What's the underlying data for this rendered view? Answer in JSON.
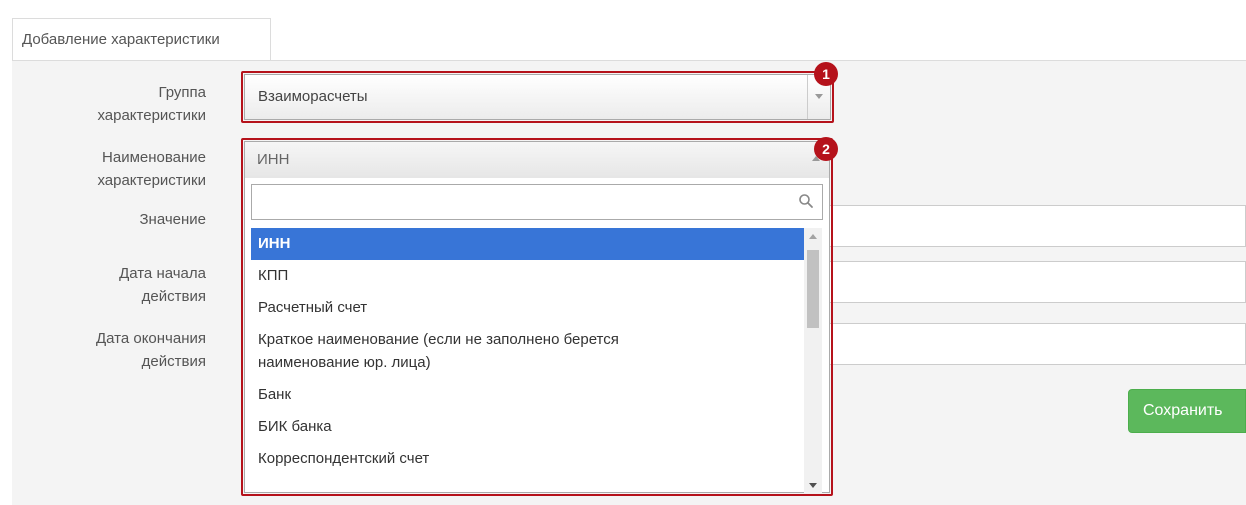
{
  "tab": {
    "label": "Добавление характеристики"
  },
  "form": {
    "group_label_1": "Группа",
    "group_label_2": "характеристики",
    "group_value": "Взаиморасчеты",
    "name_label_1": "Наименование",
    "name_label_2": "характеристики",
    "name_value": "ИНН",
    "value_label": "Значение",
    "start_label_1": "Дата начала",
    "start_label_2": "действия",
    "end_label_1": "Дата окончания",
    "end_label_2": "действия"
  },
  "dropdown": {
    "search_value": "",
    "options": [
      "ИНН",
      "КПП",
      "Расчетный счет",
      "Краткое наименование (если не заполнено берется",
      "наименование юр. лица)",
      "Банк",
      "БИК банка",
      "Корреспондентский счет"
    ],
    "selected_index": 0
  },
  "badges": {
    "one": "1",
    "two": "2"
  },
  "save_label": "Сохранить",
  "colors": {
    "highlight": "#b5121b",
    "selected": "#3875d7",
    "save": "#5cb85c"
  }
}
